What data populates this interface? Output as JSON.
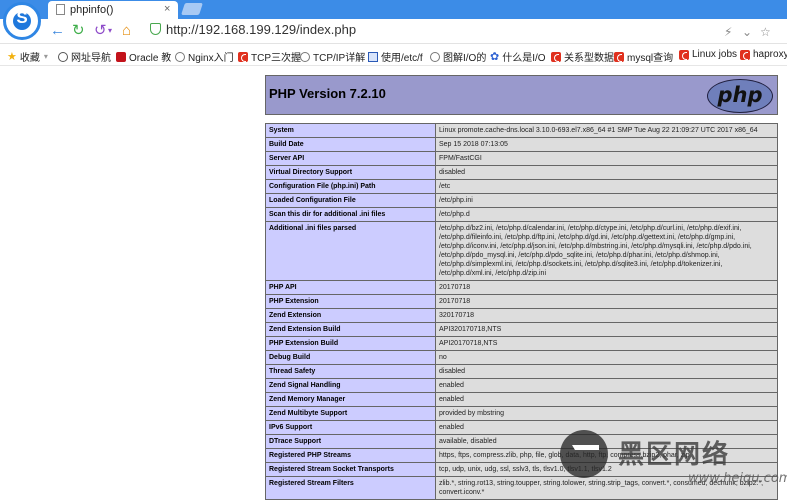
{
  "browser": {
    "tab_title": "phpinfo()",
    "tab_close": "×",
    "address": "http://192.168.199.129/index.php",
    "bookmarks": [
      {
        "label": "收藏",
        "icon": "star-icon"
      },
      {
        "label": "网址导航",
        "icon": "globe-icon"
      },
      {
        "label": "Oracle 教",
        "icon": "oracle-icon"
      },
      {
        "label": "Nginx入门",
        "icon": "nginx-icon"
      },
      {
        "label": "TCP三次握",
        "icon": "csdn-icon"
      },
      {
        "label": "TCP/IP详解",
        "icon": "nginx-icon"
      },
      {
        "label": "使用/etc/f",
        "icon": "doc-icon"
      },
      {
        "label": "图解I/O的",
        "icon": "nginx-icon"
      },
      {
        "label": "什么是I/O",
        "icon": "paw-icon"
      },
      {
        "label": "关系型数据",
        "icon": "csdn-icon"
      },
      {
        "label": "mysql查询",
        "icon": "csdn-icon"
      },
      {
        "label": "Linux jobs",
        "icon": "csdn-icon"
      },
      {
        "label": "haproxy",
        "icon": "csdn-icon"
      }
    ]
  },
  "php": {
    "version_title": "PHP Version 7.2.10",
    "logo_text": "php",
    "rows": [
      {
        "key": "System",
        "value": "Linux promote.cache-dns.local 3.10.0-693.el7.x86_64 #1 SMP Tue Aug 22 21:09:27 UTC 2017 x86_64"
      },
      {
        "key": "Build Date",
        "value": "Sep 15 2018 07:13:05"
      },
      {
        "key": "Server API",
        "value": "FPM/FastCGI"
      },
      {
        "key": "Virtual Directory Support",
        "value": "disabled"
      },
      {
        "key": "Configuration File (php.ini) Path",
        "value": "/etc"
      },
      {
        "key": "Loaded Configuration File",
        "value": "/etc/php.ini"
      },
      {
        "key": "Scan this dir for additional .ini files",
        "value": "/etc/php.d"
      },
      {
        "key": "Additional .ini files parsed",
        "value": "/etc/php.d/bz2.ini, /etc/php.d/calendar.ini, /etc/php.d/ctype.ini, /etc/php.d/curl.ini, /etc/php.d/exif.ini, /etc/php.d/fileinfo.ini, /etc/php.d/ftp.ini, /etc/php.d/gd.ini, /etc/php.d/gettext.ini, /etc/php.d/gmp.ini, /etc/php.d/iconv.ini, /etc/php.d/json.ini, /etc/php.d/mbstring.ini, /etc/php.d/mysqli.ini, /etc/php.d/pdo.ini, /etc/php.d/pdo_mysql.ini, /etc/php.d/pdo_sqlite.ini, /etc/php.d/phar.ini, /etc/php.d/shmop.ini, /etc/php.d/simplexml.ini, /etc/php.d/sockets.ini, /etc/php.d/sqlite3.ini, /etc/php.d/tokenizer.ini, /etc/php.d/xml.ini, /etc/php.d/zip.ini"
      },
      {
        "key": "PHP API",
        "value": "20170718"
      },
      {
        "key": "PHP Extension",
        "value": "20170718"
      },
      {
        "key": "Zend Extension",
        "value": "320170718"
      },
      {
        "key": "Zend Extension Build",
        "value": "API320170718,NTS"
      },
      {
        "key": "PHP Extension Build",
        "value": "API20170718,NTS"
      },
      {
        "key": "Debug Build",
        "value": "no"
      },
      {
        "key": "Thread Safety",
        "value": "disabled"
      },
      {
        "key": "Zend Signal Handling",
        "value": "enabled"
      },
      {
        "key": "Zend Memory Manager",
        "value": "enabled"
      },
      {
        "key": "Zend Multibyte Support",
        "value": "provided by mbstring"
      },
      {
        "key": "IPv6 Support",
        "value": "enabled"
      },
      {
        "key": "DTrace Support",
        "value": "available, disabled"
      },
      {
        "key": "Registered PHP Streams",
        "value": "https, ftps, compress.zlib, php, file, glob, data, http, ftp, compress.bzip2, phar, zip"
      },
      {
        "key": "Registered Stream Socket Transports",
        "value": "tcp, udp, unix, udg, ssl, sslv3, tls, tlsv1.0, tlsv1.1, tlsv1.2"
      },
      {
        "key": "Registered Stream Filters",
        "value": "zlib.*, string.rot13, string.toupper, string.tolower, string.strip_tags, convert.*, consumed, dechunk, bzip2.*, convert.iconv.*"
      }
    ]
  },
  "watermark": {
    "title": "黑区网络",
    "url": "www.heiqu.com"
  }
}
